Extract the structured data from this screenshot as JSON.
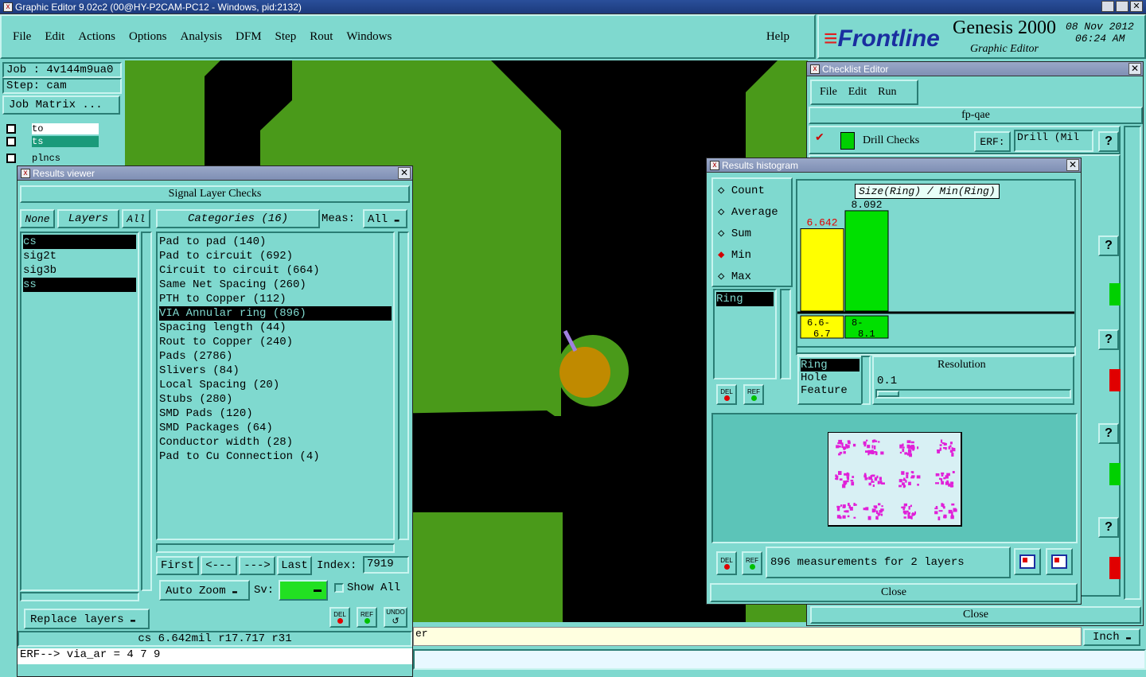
{
  "app": {
    "title": "Graphic Editor 9.02c2 (00@HY-P2CAM-PC12 - Windows, pid:2132)"
  },
  "menu": {
    "items": [
      "File",
      "Edit",
      "Actions",
      "Options",
      "Analysis",
      "DFM",
      "Step",
      "Rout",
      "Windows"
    ],
    "help": "Help"
  },
  "brand": {
    "logo": "Frontline",
    "product": "Genesis 2000",
    "subtitle": "Graphic Editor",
    "date": "08 Nov 2012",
    "time": "06:24 AM"
  },
  "job": {
    "job": "Job : 4v144m9ua0",
    "step": "Step: cam",
    "matrix": "Job Matrix ...",
    "layers": [
      "to",
      "ts",
      "plncs"
    ]
  },
  "results_viewer": {
    "title": "Results viewer",
    "header": "Signal Layer Checks",
    "none": "None",
    "layers_label": "Layers",
    "all": "All",
    "categories": "Categories (16)",
    "meas_label": "Meas:",
    "meas_value": "All",
    "layer_list": [
      "cs",
      "sig2t",
      "sig3b",
      "ss"
    ],
    "category_list": [
      "Pad to pad (140)",
      "Pad to circuit (692)",
      "Circuit to circuit (664)",
      "Same Net Spacing (260)",
      "PTH to Copper (112)",
      "VIA Annular ring (896)",
      "Spacing length (44)",
      "Rout to Copper (240)",
      "Pads (2786)",
      "Slivers (84)",
      "Local Spacing (20)",
      "Stubs (280)",
      "SMD Pads (120)",
      "SMD Packages (64)",
      "Conductor width (28)",
      "Pad to Cu Connection (4)"
    ],
    "first": "First",
    "prev": "<---",
    "next": "--->",
    "last": "Last",
    "index_label": "Index:",
    "index_value": "7919",
    "auto_zoom": "Auto Zoom",
    "sv_label": "Sv:",
    "show_all": "Show All",
    "replace_layers": "Replace layers",
    "del": "DEL",
    "ref": "REF",
    "undo": "UNDO",
    "status": "cs 6.642mil  r17.717  r31"
  },
  "erf_line": "ERF--> via_ar = 4 7 9",
  "checklist": {
    "title": "Checklist Editor",
    "menu": [
      "File",
      "Edit",
      "Run"
    ],
    "name": "fp-qae",
    "item": "Drill Checks",
    "erf_label": "ERF:",
    "erf_value": "Drill (Mil",
    "help": "?",
    "close": "Close"
  },
  "histogram": {
    "title": "Results histogram",
    "modes": [
      "Count",
      "Average",
      "Sum",
      "Min",
      "Max"
    ],
    "selected_mode": "Min",
    "chart_title": "Size(Ring) / Min(Ring)",
    "list": [
      "Ring"
    ],
    "types": [
      "Ring",
      "Hole",
      "Feature"
    ],
    "resolution_label": "Resolution",
    "resolution_value": "0.1",
    "del": "DEL",
    "ref": "REF",
    "summary": "896 measurements for 2 layers",
    "close": "Close"
  },
  "chart_data": {
    "type": "bar",
    "title": "Size(Ring) / Min(Ring)",
    "categories": [
      "6.6-6.7",
      "8-8.1"
    ],
    "values": [
      6.642,
      8.092
    ],
    "colors": [
      "#ffff00",
      "#00e000"
    ]
  },
  "bottom": {
    "units": "Inch",
    "partial": "er"
  }
}
